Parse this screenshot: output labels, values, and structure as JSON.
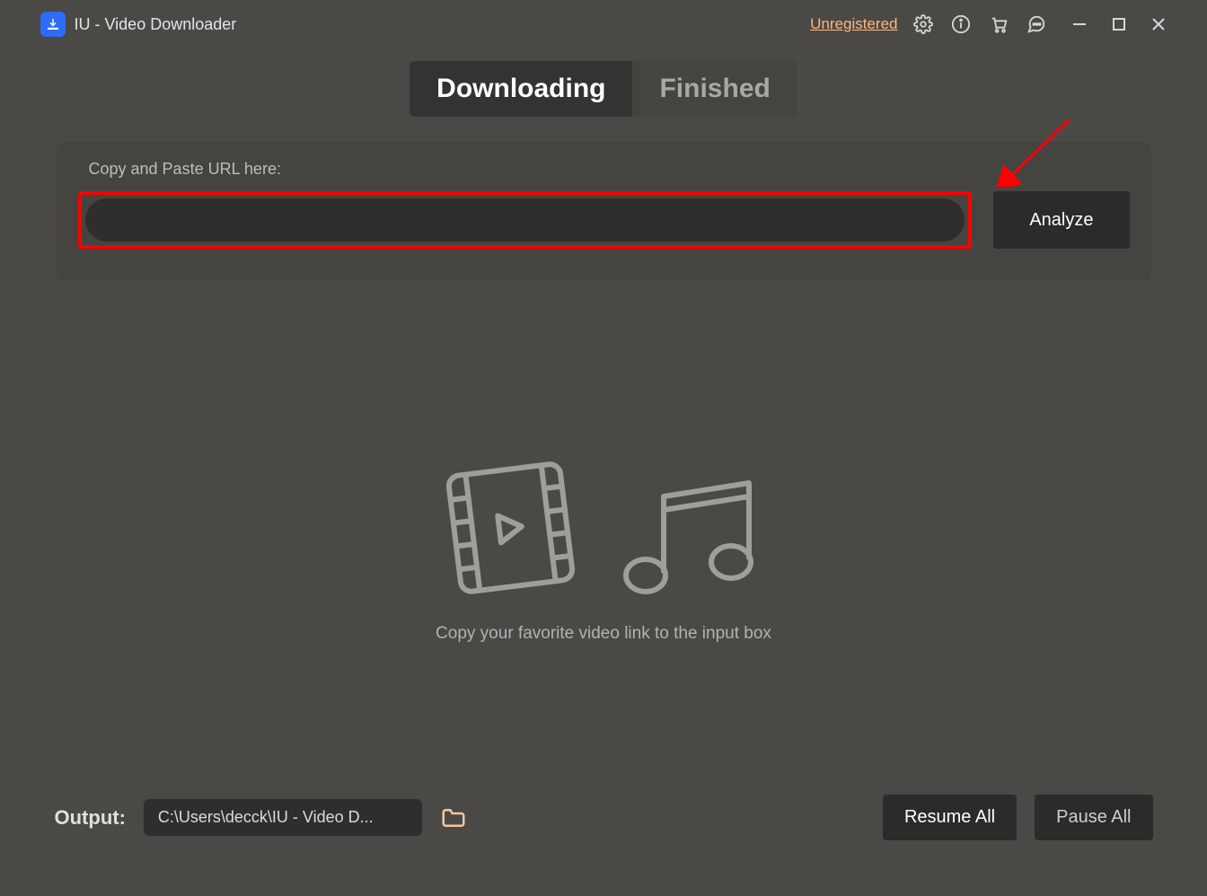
{
  "title": "IU - Video Downloader",
  "unregistered_label": "Unregistered",
  "tabs": {
    "downloading": "Downloading",
    "finished": "Finished"
  },
  "url_section": {
    "label": "Copy and Paste URL here:",
    "input_value": "",
    "input_placeholder": "",
    "analyze_button": "Analyze"
  },
  "empty_state": {
    "text": "Copy your favorite video link to the input box"
  },
  "footer": {
    "output_label": "Output:",
    "output_path": "C:\\Users\\decck\\IU - Video D...",
    "resume_all": "Resume All",
    "pause_all": "Pause All"
  },
  "icons": {
    "settings": "gear-icon",
    "info": "info-icon",
    "cart": "cart-icon",
    "feedback": "speech-bubble-icon",
    "minimize": "minimize-icon",
    "maximize": "maximize-icon",
    "close": "close-icon",
    "folder": "folder-icon",
    "video": "video-icon",
    "music": "music-icon"
  }
}
